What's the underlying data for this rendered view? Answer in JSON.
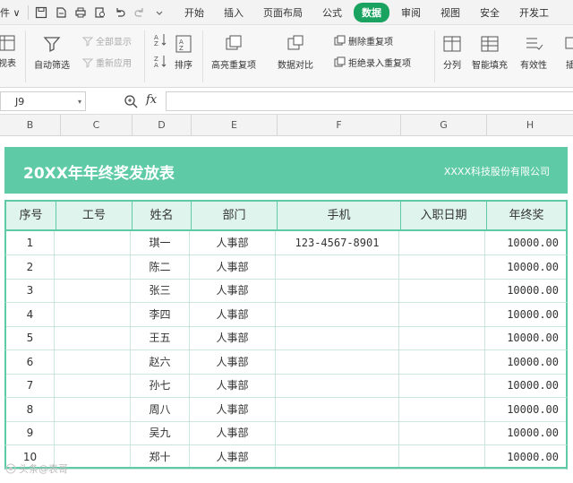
{
  "menu": {
    "file_label": "件 ∨",
    "tabs": [
      "开始",
      "插入",
      "页面布局",
      "公式",
      "数据",
      "审阅",
      "视图",
      "安全",
      "开发工"
    ],
    "active_tab_index": 4
  },
  "ribbon": {
    "pivot_label": "视表",
    "autofilter_label": "自动筛选",
    "show_all_label": "全部显示",
    "reapply_label": "重新应用",
    "sort_label": "排序",
    "highlight_dup_label": "高亮重复项",
    "data_compare_label": "数据对比",
    "remove_dup_label": "删除重复项",
    "reject_dup_label": "拒绝录入重复项",
    "split_label": "分列",
    "smart_fill_label": "智能填充",
    "validity_label": "有效性",
    "more_label": "插"
  },
  "formula_bar": {
    "cell_ref": "J9",
    "fx": "fx",
    "value": ""
  },
  "columns": [
    "B",
    "C",
    "D",
    "E",
    "F",
    "G",
    "H"
  ],
  "sheet": {
    "title": "20XX年年终奖发放表",
    "company": "XXXX科技股份有限公司",
    "headers": [
      "序号",
      "工号",
      "姓名",
      "部门",
      "手机",
      "入职日期",
      "年终奖"
    ],
    "rows": [
      {
        "no": "1",
        "id": "",
        "name": "琪一",
        "dept": "人事部",
        "phone": "123-4567-8901",
        "date": "",
        "bonus": "10000.00"
      },
      {
        "no": "2",
        "id": "",
        "name": "陈二",
        "dept": "人事部",
        "phone": "",
        "date": "",
        "bonus": "10000.00"
      },
      {
        "no": "3",
        "id": "",
        "name": "张三",
        "dept": "人事部",
        "phone": "",
        "date": "",
        "bonus": "10000.00"
      },
      {
        "no": "4",
        "id": "",
        "name": "李四",
        "dept": "人事部",
        "phone": "",
        "date": "",
        "bonus": "10000.00"
      },
      {
        "no": "5",
        "id": "",
        "name": "王五",
        "dept": "人事部",
        "phone": "",
        "date": "",
        "bonus": "10000.00"
      },
      {
        "no": "6",
        "id": "",
        "name": "赵六",
        "dept": "人事部",
        "phone": "",
        "date": "",
        "bonus": "10000.00"
      },
      {
        "no": "7",
        "id": "",
        "name": "孙七",
        "dept": "人事部",
        "phone": "",
        "date": "",
        "bonus": "10000.00"
      },
      {
        "no": "8",
        "id": "",
        "name": "周八",
        "dept": "人事部",
        "phone": "",
        "date": "",
        "bonus": "10000.00"
      },
      {
        "no": "9",
        "id": "",
        "name": "吴九",
        "dept": "人事部",
        "phone": "",
        "date": "",
        "bonus": "10000.00"
      },
      {
        "no": "10",
        "id": "",
        "name": "郑十",
        "dept": "人事部",
        "phone": "",
        "date": "",
        "bonus": "10000.00"
      }
    ]
  },
  "watermark": "头条@表哥",
  "colors": {
    "accent": "#5ecba6",
    "header_fill": "#dff4ec",
    "active_tab": "#1aa260"
  }
}
